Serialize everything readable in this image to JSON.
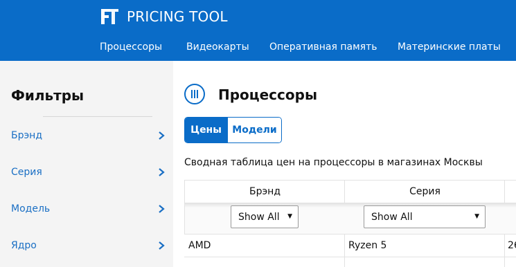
{
  "header": {
    "title": "PRICING TOOL",
    "logo_text": "FT",
    "nav": [
      "Процессоры",
      "Видеокарты",
      "Оперативная память",
      "Материнские платы"
    ]
  },
  "sidebar": {
    "title": "Фильтры",
    "filters": [
      "Брэнд",
      "Серия",
      "Модель",
      "Ядро"
    ]
  },
  "main": {
    "title": "Процессоры",
    "toggle": {
      "active": "Цены",
      "inactive": "Модели"
    },
    "caption": "Сводная таблица цен на процессоры в магазинах Москвы",
    "table": {
      "columns": [
        "Брэнд",
        "Серия"
      ],
      "filters": [
        "Show All",
        "Show All"
      ],
      "rows": [
        [
          "AMD",
          "Ryzen 5",
          "26"
        ]
      ]
    }
  },
  "colors": {
    "primary": "#0a6cc8",
    "link": "#1a6fc4",
    "sidebar_bg": "#f4f4f4"
  }
}
